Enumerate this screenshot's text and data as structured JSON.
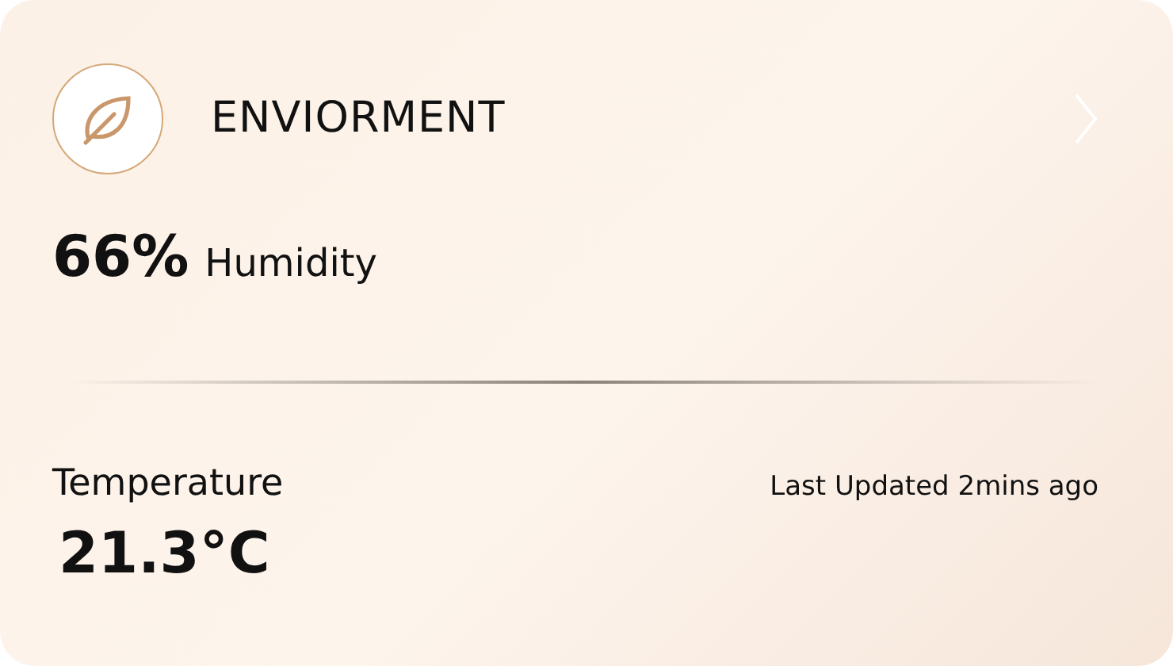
{
  "card": {
    "title": "ENVIORMENT",
    "humidity": {
      "value": "66%",
      "label": "Humidity"
    },
    "temperature": {
      "label": "Temperature",
      "value": "21.3°C"
    },
    "last_updated": "Last Updated 2mins ago"
  }
}
